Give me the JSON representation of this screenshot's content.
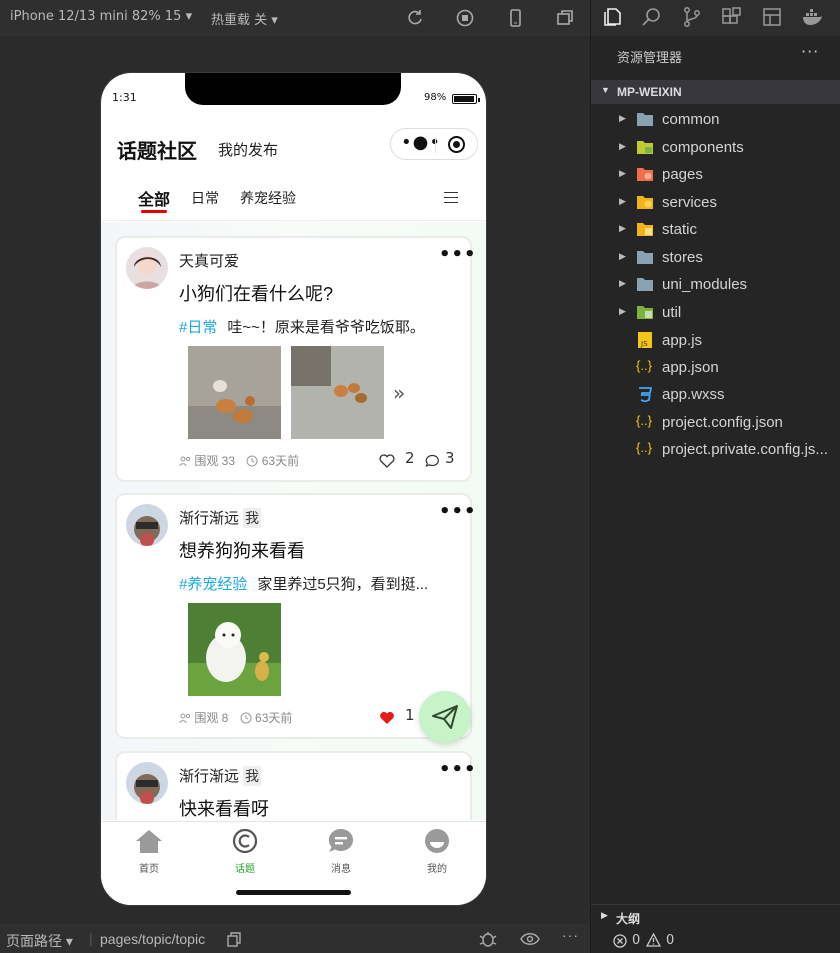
{
  "simulator": {
    "device": "iPhone 12/13 mini 82% 15 ▾",
    "hot_reload": "热重载 关 ▾"
  },
  "phone": {
    "status_time": "1:31",
    "battery": "98%",
    "page_title": "话题社区",
    "page_subtitle": "我的发布",
    "tabs": [
      "全部",
      "日常",
      "养宠经验"
    ],
    "posts": [
      {
        "user": "天真可爱",
        "is_me": "",
        "title": "小狗们在看什么呢?",
        "tag": "#日常",
        "text": "哇~~！原来是看爷爷吃饭耶。",
        "views": "围观 33",
        "time": "63天前",
        "likes": "2",
        "comments": "3"
      },
      {
        "user": "渐行渐远",
        "is_me": "我",
        "title": "想养狗狗来看看",
        "tag": "#养宠经验",
        "text": "家里养过5只狗，看到挺...",
        "views": "围观 8",
        "time": "63天前",
        "likes": "1"
      },
      {
        "user": "渐行渐远",
        "is_me": "我",
        "title": "快来看看呀"
      }
    ],
    "tabbar": [
      "首页",
      "话题",
      "消息",
      "我的"
    ]
  },
  "bottom_bar": {
    "path_label": "页面路径 ▾",
    "route": "pages/topic/topic"
  },
  "explorer": {
    "title": "资源管理器",
    "more": "···",
    "project": "MP-WEIXIN",
    "folders": [
      "common",
      "components",
      "pages",
      "services",
      "static",
      "stores",
      "uni_modules",
      "util"
    ],
    "files": [
      "app.js",
      "app.json",
      "app.wxss",
      "project.config.json",
      "project.private.config.js..."
    ],
    "outline": "大纲",
    "problems": "0",
    "warnings": "0"
  }
}
